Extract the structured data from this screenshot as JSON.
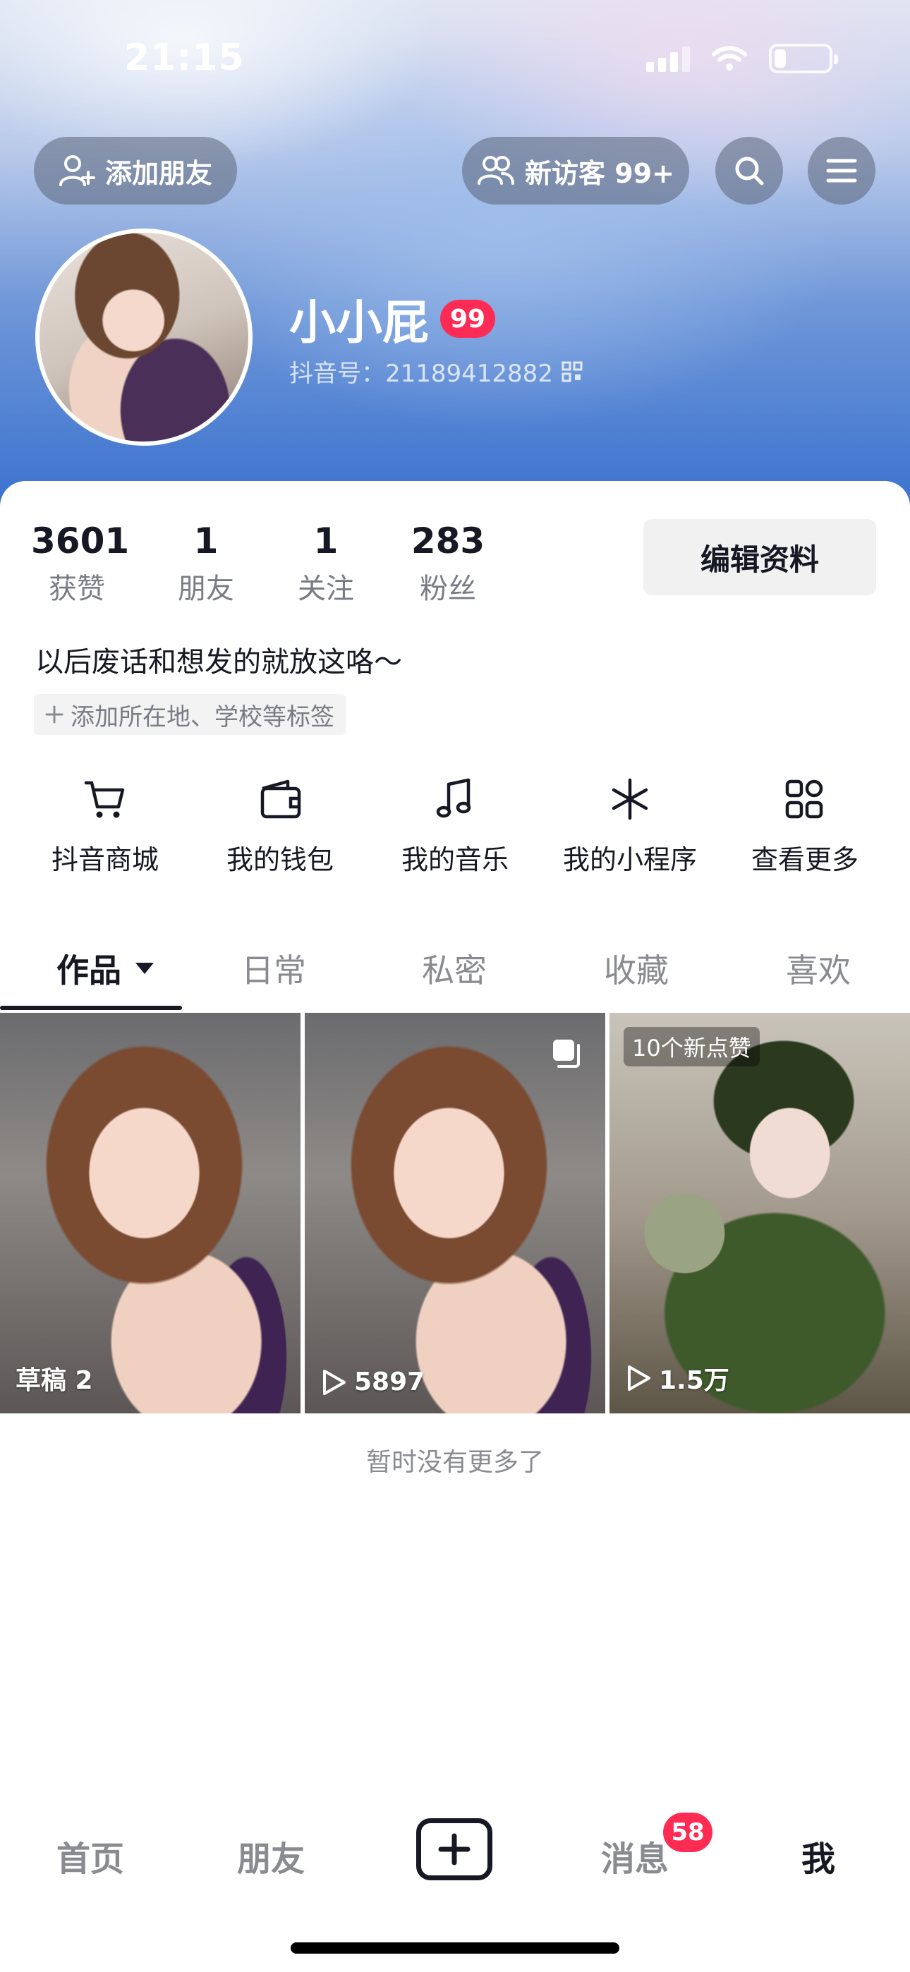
{
  "status_bar": {
    "time": "21:15"
  },
  "header": {
    "add_friend_label": "添加朋友",
    "visitors_label": "新访客 99+"
  },
  "profile": {
    "name": "小小屁",
    "level": "99",
    "douyin_id": "抖音号：21189412882",
    "bio": "以后废话和想发的就放这咯～",
    "tag_chip": "添加所在地、学校等标签",
    "edit_button": "编辑资料"
  },
  "stats": [
    {
      "value": "3601",
      "label": "获赞"
    },
    {
      "value": "1",
      "label": "朋友"
    },
    {
      "value": "1",
      "label": "关注"
    },
    {
      "value": "283",
      "label": "粉丝"
    }
  ],
  "shortcuts": [
    {
      "label": "抖音商城",
      "icon": "cart-icon"
    },
    {
      "label": "我的钱包",
      "icon": "wallet-icon"
    },
    {
      "label": "我的音乐",
      "icon": "music-note-icon"
    },
    {
      "label": "我的小程序",
      "icon": "mini-program-icon"
    },
    {
      "label": "查看更多",
      "icon": "grid-more-icon"
    }
  ],
  "tabs": [
    "作品",
    "日常",
    "私密",
    "收藏",
    "喜欢"
  ],
  "videos": [
    {
      "caption": "草稿 2"
    },
    {
      "caption": "5897"
    },
    {
      "caption": "1.5万",
      "badge": "10个新点赞"
    }
  ],
  "no_more_text": "暂时没有更多了",
  "bottom_nav": {
    "home": "首页",
    "friends": "朋友",
    "messages": "消息",
    "messages_badge": "58",
    "me": "我"
  },
  "colors": {
    "accent": "#fe2c55",
    "text_primary": "#161823",
    "text_secondary": "#8a8b91"
  }
}
